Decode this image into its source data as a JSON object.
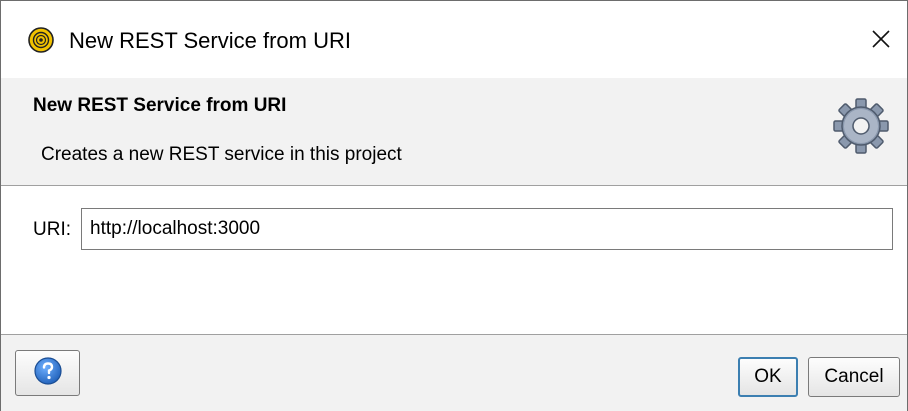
{
  "window": {
    "title": "New REST Service from URI",
    "close_symbol": "✕",
    "icons": {
      "app": "soapui-app-icon",
      "close": "close-icon"
    }
  },
  "banner": {
    "title": "New REST Service from URI",
    "description": "Creates a new REST service in this project",
    "icon": "gear-icon"
  },
  "form": {
    "uri_label": "URI:",
    "uri_value": "http://localhost:3000"
  },
  "footer": {
    "help_icon": "help-icon",
    "ok_label": "OK",
    "cancel_label": "Cancel"
  },
  "colors": {
    "banner_bg": "#f2f2f2",
    "ok_border": "#3c7fb1",
    "help_blue": "#2a6fc9",
    "app_icon_yellow": "#f2c200"
  }
}
